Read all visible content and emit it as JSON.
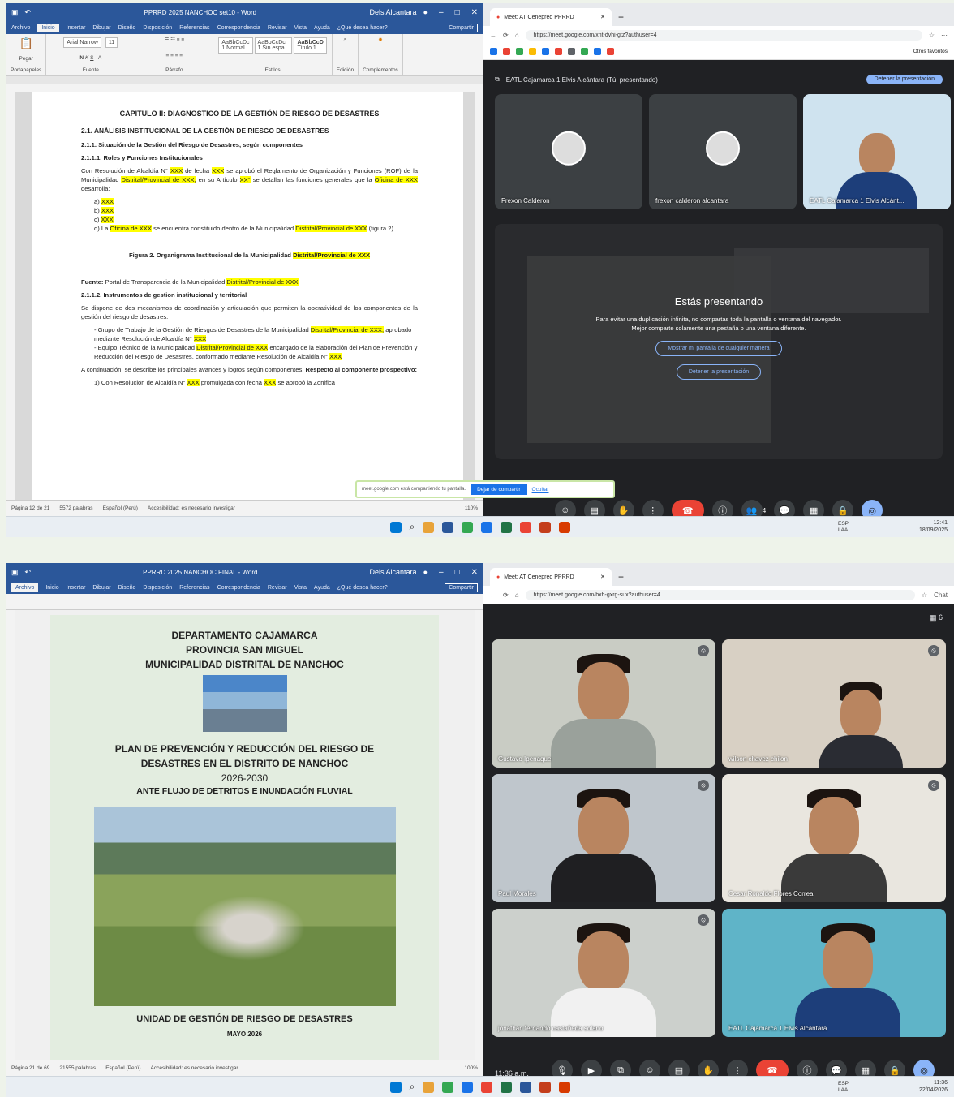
{
  "shot1": {
    "word": {
      "title": "PPRRD 2025 NANCHOC set10 - Word",
      "user": "Dels Alcantara",
      "tabs": [
        "Archivo",
        "Inicio",
        "Insertar",
        "Dibujar",
        "Diseño",
        "Disposición",
        "Referencias",
        "Correspondencia",
        "Revisar",
        "Vista",
        "Ayuda",
        "¿Qué desea hacer?"
      ],
      "share": "Compartir",
      "font_name": "Arial Narrow",
      "font_size": "11",
      "paste": "Pegar",
      "clipboard": "Portapapeles",
      "font_group": "Fuente",
      "paragraph_group": "Párrafo",
      "styles_group": "Estilos",
      "styles": [
        {
          "sample": "AaBbCcDc",
          "name": "1 Normal"
        },
        {
          "sample": "AaBbCcDc",
          "name": "1 Sin espa..."
        },
        {
          "sample": "AaBbCcD",
          "name": "Título 1"
        }
      ],
      "edit": "Edición",
      "addins": "Complementos",
      "status_page": "Página 12 de 21",
      "status_words": "5572 palabras",
      "status_lang": "Español (Perú)",
      "status_access": "Accesibilidad: es necesario investigar",
      "zoom": "110%",
      "doc": {
        "h": "CAPITULO II: DIAGNOSTICO DE LA GESTIÓN DE RIESGO DE DESASTRES",
        "s1": "2.1. ANÁLISIS INSTITUCIONAL DE LA GESTIÓN DE RIESGO DE DESASTRES",
        "s2": "2.1.1. Situación de la Gestión del Riesgo de Desastres, según componentes",
        "s3": "2.1.1.1. Roles y Funciones Institucionales",
        "p1a": "Con Resolución de Alcaldía N°",
        "p1b": "de fecha",
        "p1c": "se aprobó el Reglamento de Organización y Funciones (ROF) de la Municipalidad",
        "p1d": "Distrital/Provincial de XXX,",
        "p1e": "en su Artículo",
        "p1f": "XX°",
        "p1g": "se detallan las funciones generales que la",
        "p1h": "Oficina de XXX",
        "p1i": "desarrolla:",
        "xxx": "XXX",
        "list": [
          "a)",
          "b)",
          "c)"
        ],
        "ld": "d) La",
        "ld2": "Oficina de XXX",
        "ld3": "se encuentra constituido dentro de la Municipalidad",
        "ld4": "Distrital/Provincial de XXX",
        "ld5": "(figura 2)",
        "fig": "Figura 2. Organigrama Institucional de la Municipalidad",
        "fig2": "Distrital/Provincial de XXX",
        "src": "Fuente:",
        "src2": "Portal de Transparencia de la Municipalidad",
        "src3": "Distrital/Provincial de XXX",
        "s4": "2.1.1.2. Instrumentos de gestion institucional y territorial",
        "p2": "Se dispone de dos mecanismos de coordinación y articulación que permiten la operatividad de los componentes de la gestión del riesgo de desastres:",
        "b1": "Grupo de Trabajo de la Gestión de Riesgos de Desastres de la Municipalidad",
        "b1h": "Distrital/Provincial de XXX,",
        "b1c": "aprobado mediante Resolución de Alcaldía N°",
        "b2": "Equipo Técnico de la Municipalidad",
        "b2h": "Distrital/Provincial de XXX",
        "b2c": "encargado de la elaboración del Plan de Prevención y Reducción del Riesgo de Desastres, conformado mediante Resolución de Alcaldía N°",
        "p3": "A continuación, se describe los principales avances y logros según componentes.",
        "p3b": "Respecto al componente prospectivo:",
        "n1": "1) Con Resolución de Alcaldía N°",
        "n1b": "promulgada con fecha",
        "n1c": "se aprobó la Zonifica"
      }
    },
    "meet": {
      "tab": "Meet: AT Cenepred PPRRD",
      "url": "https://meet.google.com/xnt-dvhi-gtz?authuser=4",
      "favorites": "Otros favoritos",
      "presenting": "EATL Cajamarca 1 Elvis Alcántara (Tú, presentando)",
      "stop": "Detener la presentación",
      "tiles": [
        "Frexon Calderon",
        "frexon calderon alcantara",
        "EATL Cajamarca 1 Elvis Alcánt..."
      ],
      "share_title": "Estás presentando",
      "share_msg": "Para evitar una duplicación infinita, no compartas toda la pantalla o ventana del navegador. Mejor comparte solamente una pestaña o una ventana diferente.",
      "share_btn1": "Mostrar mi pantalla de cualquier manera",
      "share_btn2": "Detener la presentación",
      "notice": "meet.google.com está compartiendo tu pantalla.",
      "notice_stop": "Dejar de compartir",
      "notice_hide": "Ocultar",
      "people_count": "4"
    },
    "taskbar": {
      "lang": "ESP",
      "lang2": "LAA",
      "time": "12:41",
      "date": "18/09/2025"
    }
  },
  "shot2": {
    "word": {
      "title": "PPRRD 2025 NANCHOC FINAL - Word",
      "user": "Dels Alcantara",
      "tabs": [
        "Archivo",
        "Inicio",
        "Insertar",
        "Dibujar",
        "Diseño",
        "Disposición",
        "Referencias",
        "Correspondencia",
        "Revisar",
        "Vista",
        "Ayuda",
        "¿Qué desea hacer?"
      ],
      "share": "Compartir",
      "status_page": "Página 21 de 69",
      "status_words": "21555 palabras",
      "status_lang": "Español (Perú)",
      "status_access": "Accesibilidad: es necesario investigar",
      "zoom": "100%",
      "cover": {
        "l1": "DEPARTAMENTO CAJAMARCA",
        "l2": "PROVINCIA SAN MIGUEL",
        "l3": "MUNICIPALIDAD DISTRITAL DE NANCHOC",
        "t1": "PLAN DE PREVENCIÓN Y REDUCCIÓN DEL RIESGO DE",
        "t2": "DESASTRES EN EL DISTRITO DE NANCHOC",
        "t3": "2026-2030",
        "t4": "ANTE FLUJO DE DETRITOS E INUNDACIÓN FLUVIAL",
        "foot": "UNIDAD DE GESTIÓN DE RIESGO DE DESASTRES",
        "date": "MAYO 2026"
      }
    },
    "meet": {
      "tab": "Meet: AT Cenepred PPRRD",
      "url": "https://meet.google.com/bxh-gxrg-sux?authuser=4",
      "chat": "Chat",
      "people_count": "6",
      "tiles": [
        "Gustavo Ipenaque",
        "wilson chavez chilon",
        "Paul Morales",
        "Cesar Ronaldo Flores Correa",
        "jonathan fernando castañeda solano",
        "EATL Cajamarca 1 Elvis Alcantara"
      ],
      "time": "11:36 a.m."
    },
    "taskbar": {
      "lang": "ESP",
      "lang2": "LAA",
      "time": "11:36",
      "date": "22/04/2026"
    }
  },
  "colors": {
    "word_blue": "#2b579a",
    "meet_bg": "#202124",
    "highlight": "#ffff00",
    "end_call": "#ea4335",
    "meet_accent": "#8ab4f8"
  }
}
